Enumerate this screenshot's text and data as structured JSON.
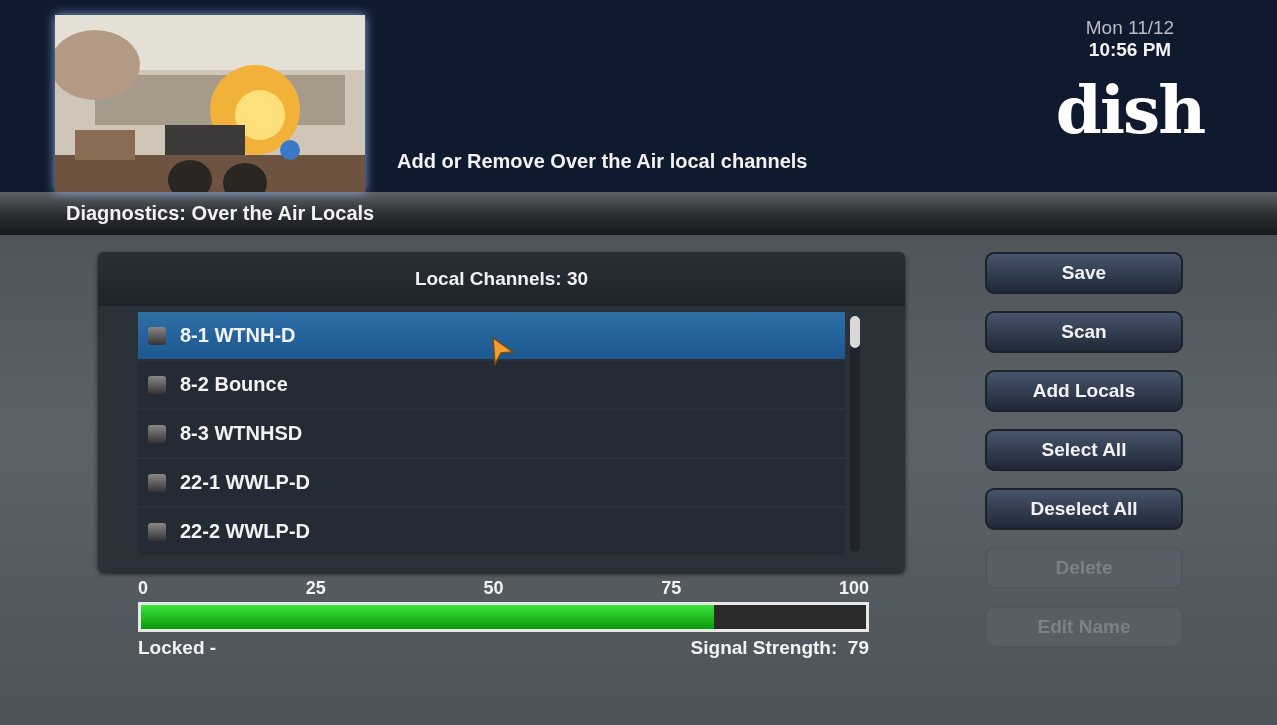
{
  "header": {
    "description": "Add or Remove Over the Air local channels",
    "date": "Mon 11/12",
    "time": "10:56 PM",
    "logo": "dish"
  },
  "title_bar": {
    "title": "Diagnostics: Over the Air Locals"
  },
  "channel_list": {
    "heading": "Local Channels: 30",
    "rows": [
      {
        "label": "8-1 WTNH-D",
        "selected": true
      },
      {
        "label": "8-2 Bounce",
        "selected": false
      },
      {
        "label": "8-3 WTNHSD",
        "selected": false
      },
      {
        "label": "22-1 WWLP-D",
        "selected": false
      },
      {
        "label": "22-2 WWLP-D",
        "selected": false
      }
    ]
  },
  "signal_meter": {
    "ticks": [
      "0",
      "25",
      "50",
      "75",
      "100"
    ],
    "level": 0.79,
    "status": "Locked -",
    "reading": "Signal Strength:  79"
  },
  "buttons": [
    {
      "label": "Save",
      "disabled": false
    },
    {
      "label": "Scan",
      "disabled": false
    },
    {
      "label": "Add Locals",
      "disabled": false
    },
    {
      "label": "Select All",
      "disabled": false
    },
    {
      "label": "Deselect All",
      "disabled": false
    },
    {
      "label": "Delete",
      "disabled": true
    },
    {
      "label": "Edit Name",
      "disabled": true
    }
  ]
}
